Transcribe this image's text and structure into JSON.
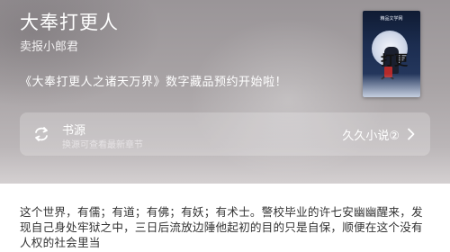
{
  "book": {
    "title": "大奉打更人",
    "author": "卖报小郎君",
    "announcement": "《大奉打更人之诸天万界》数字藏品预约开始啦！"
  },
  "cover": {
    "publisher_text": "精品文学网",
    "title_text": "打更人"
  },
  "source": {
    "label": "书源",
    "hint": "换源可查看最新章节",
    "value": "久久小说②",
    "icon": "swap-icon",
    "chevron_icon": "chevron-right-icon"
  },
  "intro": {
    "text": "这个世界，有儒；有道；有佛；有妖；有术士。警校毕业的许七安幽幽醒来，发现自己身处牢狱之中，三日后流放边陲他起初的目的只是自保，顺便在这个没有人权的社会里当"
  },
  "colors": {
    "hero_bg": "#a8a3a5",
    "text_light": "#ffffff",
    "intro_text": "#333333"
  }
}
